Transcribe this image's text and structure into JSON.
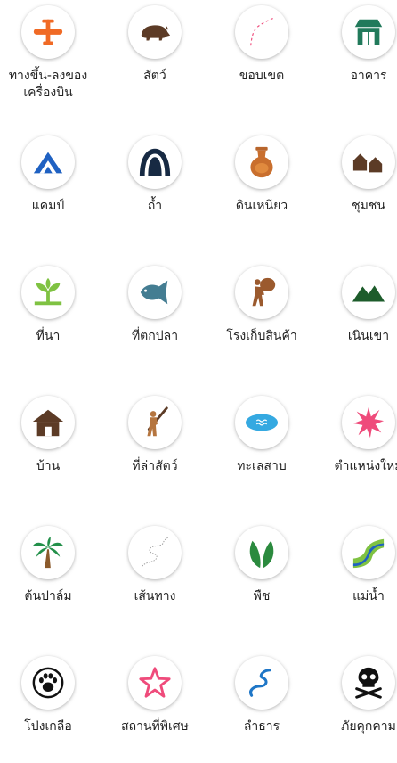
{
  "palette": {
    "orange": "#f06a25",
    "brown": "#5c3b26",
    "green": "#217a5b",
    "navy": "#172a43",
    "blue": "#1f61c2",
    "lightblue": "#35a9e1",
    "pink": "#ef4b7b",
    "leafgreen": "#2b8a3e",
    "lightgreen": "#7fc242"
  },
  "categories": [
    {
      "label": "ทางขึ้น-ลงของ\nเครื่องบิน",
      "icon": "airplane-icon"
    },
    {
      "label": "สัตว์",
      "icon": "animal-icon"
    },
    {
      "label": "ขอบเขต",
      "icon": "boundary-icon"
    },
    {
      "label": "อาคาร",
      "icon": "building-icon"
    },
    {
      "label": "แคมป์",
      "icon": "camp-icon"
    },
    {
      "label": "ถ้ำ",
      "icon": "cave-icon"
    },
    {
      "label": "ดินเหนียว",
      "icon": "clay-pot-icon"
    },
    {
      "label": "ชุมชน",
      "icon": "community-icon"
    },
    {
      "label": "ที่นา",
      "icon": "field-icon"
    },
    {
      "label": "ที่ตกปลา",
      "icon": "fish-icon"
    },
    {
      "label": "โรงเก็บสินค้า",
      "icon": "porter-icon"
    },
    {
      "label": "เนินเขา",
      "icon": "hill-icon"
    },
    {
      "label": "บ้าน",
      "icon": "house-icon"
    },
    {
      "label": "ที่ล่าสัตว์",
      "icon": "hunter-icon"
    },
    {
      "label": "ทะเลสาบ",
      "icon": "lake-icon"
    },
    {
      "label": "ตำแหน่งใหม่",
      "icon": "burst-icon"
    },
    {
      "label": "ต้นปาล์ม",
      "icon": "palm-tree-icon"
    },
    {
      "label": "เส้นทาง",
      "icon": "path-icon"
    },
    {
      "label": "พืช",
      "icon": "plant-icon"
    },
    {
      "label": "แม่น้ำ",
      "icon": "river-icon"
    },
    {
      "label": "โป่งเกลือ",
      "icon": "paw-icon"
    },
    {
      "label": "สถานที่พิเศษ",
      "icon": "star-icon"
    },
    {
      "label": "ลำธาร",
      "icon": "stream-icon"
    },
    {
      "label": "ภัยคุกคาม",
      "icon": "skull-icon"
    }
  ]
}
